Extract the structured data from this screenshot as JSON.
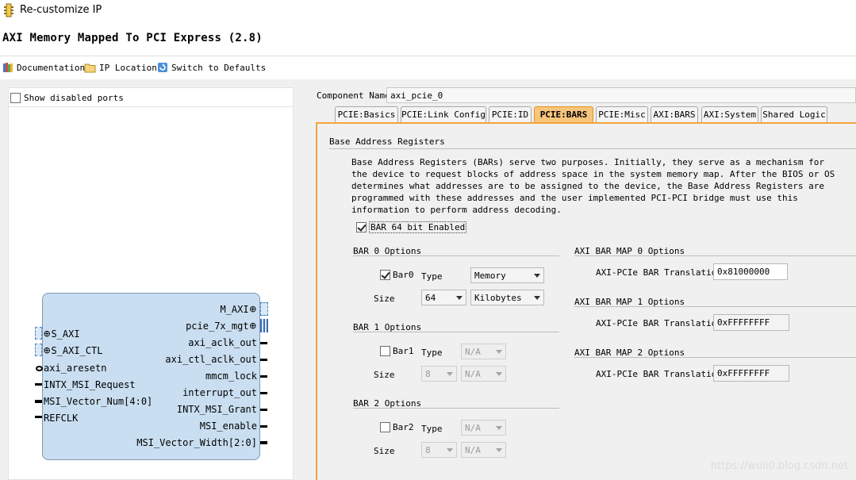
{
  "window": {
    "title": "Re-customize IP",
    "ip_heading": "AXI Memory Mapped To PCI Express (2.8)"
  },
  "toolbar": {
    "documentation": "Documentation",
    "ip_location": "IP Location",
    "switch_defaults": "Switch to Defaults"
  },
  "left_panel": {
    "show_disabled_ports": "Show disabled ports",
    "show_disabled_checked": false,
    "block": {
      "left_ports": [
        "S_AXI",
        "S_AXI_CTL",
        "axi_aresetn",
        "INTX_MSI_Request",
        "MSI_Vector_Num[4:0]",
        "REFCLK"
      ],
      "right_ports": [
        "M_AXI",
        "pcie_7x_mgt",
        "axi_aclk_out",
        "axi_ctl_aclk_out",
        "mmcm_lock",
        "interrupt_out",
        "INTX_MSI_Grant",
        "MSI_enable",
        "MSI_Vector_Width[2:0]"
      ]
    }
  },
  "component": {
    "label": "Component Name",
    "value": "axi_pcie_0"
  },
  "tabs": [
    {
      "label": "PCIE:Basics",
      "active": false
    },
    {
      "label": "PCIE:Link Config",
      "active": false
    },
    {
      "label": "PCIE:ID",
      "active": false
    },
    {
      "label": "PCIE:BARS",
      "active": true
    },
    {
      "label": "PCIE:Misc",
      "active": false
    },
    {
      "label": "AXI:BARS",
      "active": false
    },
    {
      "label": "AXI:System",
      "active": false
    },
    {
      "label": "Shared Logic",
      "active": false
    }
  ],
  "bars": {
    "section_title": "Base Address Registers",
    "description": "Base Address Registers (BARs) serve two purposes. Initially, they serve as a mechanism for the device to request blocks of address space in the system memory map. After the BIOS or OS determines what addresses are to be assigned to the device, the Base Address Registers are programmed with these addresses and the user implemented PCI-PCI bridge must use this information to perform address decoding.",
    "bar64_label": "BAR 64 bit Enabled",
    "bar64_checked": true,
    "type_label": "Type",
    "size_label": "Size",
    "bar0": {
      "title": "BAR 0 Options",
      "checkbox": "Bar0",
      "checked": true,
      "type": "Memory",
      "size": "64",
      "unit": "Kilobytes"
    },
    "bar1": {
      "title": "BAR 1 Options",
      "checkbox": "Bar1",
      "checked": false,
      "type": "N/A",
      "size": "8",
      "unit": "N/A"
    },
    "bar2": {
      "title": "BAR 2 Options",
      "checkbox": "Bar2",
      "checked": false,
      "type": "N/A",
      "size": "8",
      "unit": "N/A"
    },
    "translation_label": "AXI-PCIe BAR Translation",
    "map0": {
      "title": "AXI BAR MAP 0 Options",
      "value": "0x81000000"
    },
    "map1": {
      "title": "AXI BAR MAP 1 Options",
      "value": "0xFFFFFFFF"
    },
    "map2": {
      "title": "AXI BAR MAP 2 Options",
      "value": "0xFFFFFFFF"
    }
  },
  "watermark": "https://wuli0.blog.csdn.net"
}
